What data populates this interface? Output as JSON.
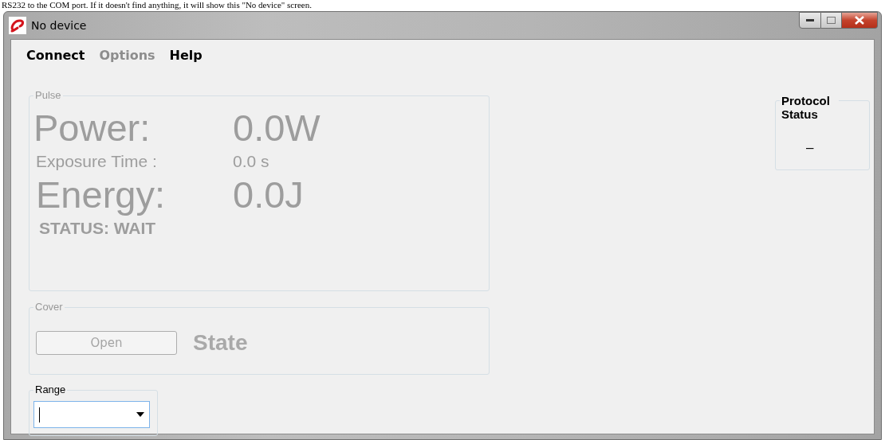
{
  "document_text": "RS232 to the COM port. If it doesn't find anything, it will show this \"No device\" screen.",
  "window": {
    "title": "No device"
  },
  "menu": [
    {
      "label": "Connect",
      "disabled": false
    },
    {
      "label": "Options",
      "disabled": true
    },
    {
      "label": "Help",
      "disabled": false
    }
  ],
  "pulse": {
    "title": "Pulse",
    "power_label": "Power:",
    "power_value": "0.0W",
    "exposure_label": "Exposure Time :",
    "exposure_value": "0.0 s",
    "energy_label": "Energy:",
    "energy_value": "0.0J",
    "status": "STATUS: WAIT"
  },
  "cover": {
    "title": "Cover",
    "button": {
      "label": "Open",
      "disabled": true
    },
    "state": "State"
  },
  "range": {
    "title": "Range"
  },
  "protocol_status": {
    "title": "Protocol Status",
    "value": "–"
  }
}
